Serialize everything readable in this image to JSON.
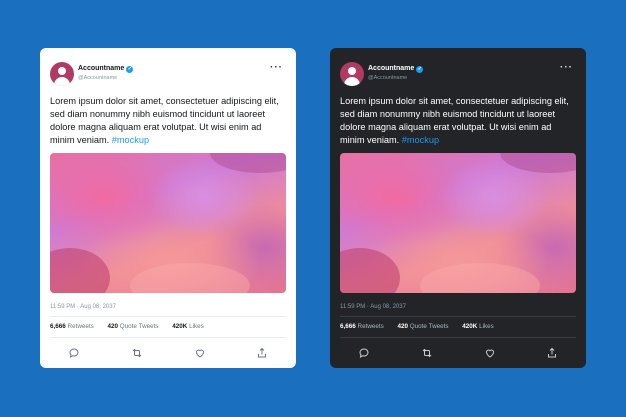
{
  "cards": [
    {
      "theme": "light",
      "account_name": "Accountname",
      "handle": "@Accountname",
      "text": "Lorem ipsum dolor sit amet, consectetuer adipiscing elit, sed diam nonummy nibh euismod tincidunt ut laoreet dolore magna aliquam erat volutpat. Ut wisi enim ad minim veniam.",
      "hashtag": "#mockup",
      "timestamp": "11:59 PM · Aug 08, 2037",
      "retweets_count": "6,666",
      "retweets_label": "Retweets",
      "quotes_count": "420",
      "quotes_label": "Quote Tweets",
      "likes_count": "420K",
      "likes_label": "Likes",
      "icons": [
        "verified-icon",
        "more-icon",
        "reply-icon",
        "retweet-icon",
        "like-icon",
        "share-icon"
      ]
    },
    {
      "theme": "dark",
      "account_name": "Accountname",
      "handle": "@Accountname",
      "text": "Lorem ipsum dolor sit amet, consectetuer adipiscing elit, sed diam nonummy nibh euismod tincidunt ut laoreet dolore magna aliquam erat volutpat. Ut wisi enim ad minim veniam.",
      "hashtag": "#mockup",
      "timestamp": "11:59 PM · Aug 08, 2037",
      "retweets_count": "6,666",
      "retweets_label": "Retweets",
      "quotes_count": "420",
      "quotes_label": "Quote Tweets",
      "likes_count": "420K",
      "likes_label": "Likes",
      "icons": [
        "verified-icon",
        "more-icon",
        "reply-icon",
        "retweet-icon",
        "like-icon",
        "share-icon"
      ]
    }
  ],
  "colors": {
    "background": "#1a6fbf",
    "light_card": "#ffffff",
    "dark_card": "#222427",
    "accent": "#1d9bf0",
    "avatar": "#b03a63"
  }
}
